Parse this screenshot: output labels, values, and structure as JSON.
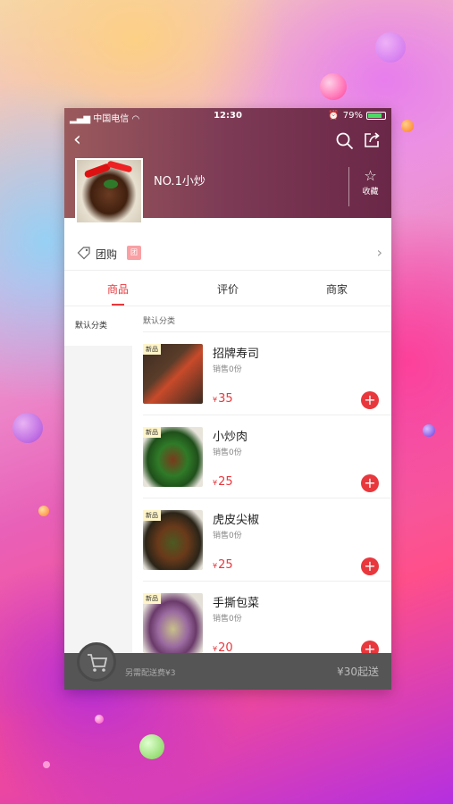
{
  "status_bar": {
    "carrier": "中国电信",
    "time": "12:30",
    "battery": "79%"
  },
  "shop": {
    "name": "NO.1小炒",
    "favorite_label": "收藏"
  },
  "group_buy": {
    "label": "团购",
    "badge": "团"
  },
  "tabs": [
    {
      "label": "商品",
      "active": true
    },
    {
      "label": "评价",
      "active": false
    },
    {
      "label": "商家",
      "active": false
    }
  ],
  "sidebar": {
    "items": [
      {
        "label": "默认分类"
      }
    ]
  },
  "category_title": "默认分类",
  "items": [
    {
      "badge": "新品",
      "name": "招牌寿司",
      "sales": "销售0份",
      "currency": "¥",
      "price": "35"
    },
    {
      "badge": "新品",
      "name": "小炒肉",
      "sales": "销售0份",
      "currency": "¥",
      "price": "25"
    },
    {
      "badge": "新品",
      "name": "虎皮尖椒",
      "sales": "销售0份",
      "currency": "¥",
      "price": "25"
    },
    {
      "badge": "新品",
      "name": "手撕包菜",
      "sales": "销售0份",
      "currency": "¥",
      "price": "20"
    }
  ],
  "cart": {
    "delivery_fee": "另需配送费¥3",
    "minimum": "¥30起送"
  },
  "colors": {
    "accent": "#e8383d",
    "header": "#7d3a55"
  }
}
